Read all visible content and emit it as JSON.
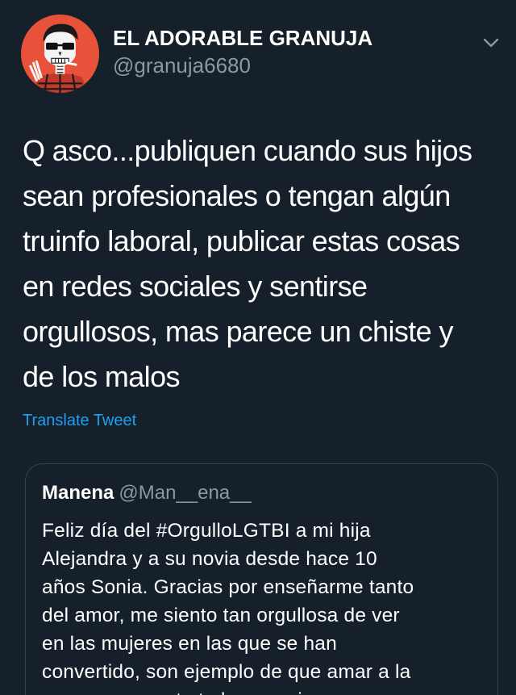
{
  "author": {
    "display_name": "EL ADORABLE GRANUJA",
    "handle": "@granuja6680",
    "avatar_icon": "skull-avatar"
  },
  "tweet": {
    "text": "Q asco...publiquen cuando sus hijos\nsean profesionales o tengan algún\ntruinfo laboral, publicar estas cosas\nen redes sociales y sentirse\norgullosos, mas parece un chiste y\nde los malos",
    "translate_label": "Translate Tweet"
  },
  "quoted_tweet": {
    "author_name": "Manena",
    "author_handle": "@Man__ena__",
    "text": "Feliz día del #OrgulloLGTBI a mi hija\nAlejandra y a su novia desde hace 10\naños Sonia. Gracias por enseñarme  tanto\ndel amor, me siento tan orgullosa de ver\nen las mujeres en las que se han\nconvertido, son ejemplo de que amar a la\npersona correcta te hace mejor."
  },
  "colors": {
    "background": "#15202b",
    "text": "#ffffff",
    "secondary_text": "#8899a6",
    "link": "#1da1f2",
    "border": "#38444d",
    "avatar_bg": "#e8513a"
  },
  "icons": {
    "menu": "chevron-down-icon"
  }
}
